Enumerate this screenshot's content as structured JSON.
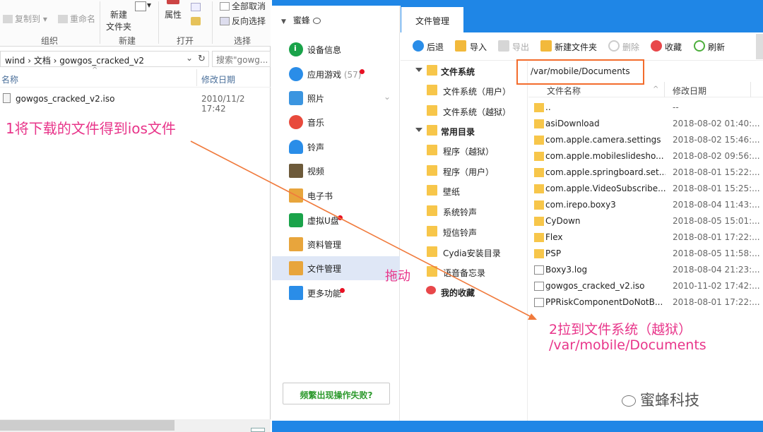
{
  "explorer": {
    "ribbon": {
      "copy_to": "复制到",
      "rename": "重命名",
      "new_folder_line1": "新建",
      "new_folder_line2": "文件夹",
      "properties": "属性",
      "select_none": "全部取消",
      "invert_select": "反向选择",
      "groups": [
        "组织",
        "新建",
        "打开",
        "选择"
      ]
    },
    "breadcrumb": [
      "wind",
      "文档",
      "gowgos_cracked_v2"
    ],
    "search_placeholder": "搜索\"gowg...",
    "columns": {
      "name": "名称",
      "date": "修改日期"
    },
    "files": [
      {
        "name": "gowgos_cracked_v2.iso",
        "date": "2010/11/2 17:42"
      }
    ]
  },
  "app": {
    "device_name": "蜜蜂",
    "nav": [
      {
        "label": "设备信息",
        "icon": "info-icon",
        "color": "#1aa34a"
      },
      {
        "label": "应用游戏",
        "badge": "(57)",
        "icon": "appstore-icon",
        "color": "#2a8de8"
      },
      {
        "label": "照片",
        "icon": "photo-icon",
        "color": "#3b95e0"
      },
      {
        "label": "音乐",
        "icon": "music-icon",
        "color": "#e84a3c"
      },
      {
        "label": "铃声",
        "icon": "bell-icon",
        "color": "#2a8de8"
      },
      {
        "label": "视频",
        "icon": "film-icon",
        "color": "#6d5a3a"
      },
      {
        "label": "电子书",
        "icon": "book-icon",
        "color": "#e8a53c"
      },
      {
        "label": "虚拟U盘",
        "icon": "usb-icon",
        "color": "#1aa34a"
      },
      {
        "label": "资料管理",
        "icon": "contacts-icon",
        "color": "#e8a53c"
      },
      {
        "label": "文件管理",
        "icon": "files-icon",
        "color": "#e8a53c"
      },
      {
        "label": "更多功能",
        "icon": "grid-icon",
        "color": "#2a8de8"
      }
    ],
    "warn_button": "频繁出现操作失败?",
    "tab": "文件管理",
    "toolbar": {
      "back": "后退",
      "import": "导入",
      "export": "导出",
      "new_folder": "新建文件夹",
      "delete": "删除",
      "favorite": "收藏",
      "refresh": "刷新"
    },
    "tree": {
      "filesystem": "文件系统",
      "fs_user": "文件系统（用户）",
      "fs_jail": "文件系统（越狱）",
      "common": "常用目录",
      "common_items": [
        "程序（越狱）",
        "程序（用户）",
        "壁纸",
        "系统铃声",
        "短信铃声",
        "Cydia安装目录",
        "语音备忘录"
      ],
      "favorites": "我的收藏"
    },
    "path": "/var/mobile/Documents",
    "list_columns": {
      "name": "文件名称",
      "date": "修改日期"
    },
    "files": [
      {
        "name": "..",
        "date": "--",
        "type": "folder"
      },
      {
        "name": "asiDownload",
        "date": "2018-08-02 01:40:...",
        "type": "folder"
      },
      {
        "name": "com.apple.camera.settings",
        "date": "2018-08-02 15:46:...",
        "type": "folder"
      },
      {
        "name": "com.apple.mobileslidesho...",
        "date": "2018-08-02 09:56:...",
        "type": "folder"
      },
      {
        "name": "com.apple.springboard.set...",
        "date": "2018-08-01 15:22:...",
        "type": "folder"
      },
      {
        "name": "com.apple.VideoSubscribe...",
        "date": "2018-08-01 15:25:...",
        "type": "folder"
      },
      {
        "name": "com.irepo.boxy3",
        "date": "2018-08-04 11:43:...",
        "type": "folder"
      },
      {
        "name": "CyDown",
        "date": "2018-08-05 15:01:...",
        "type": "folder"
      },
      {
        "name": "Flex",
        "date": "2018-08-01 17:22:...",
        "type": "folder"
      },
      {
        "name": "PSP",
        "date": "2018-08-05 11:58:...",
        "type": "folder"
      },
      {
        "name": "Boxy3.log",
        "date": "2018-08-04 21:23:...",
        "type": "file"
      },
      {
        "name": "gowgos_cracked_v2.iso",
        "date": "2010-11-02 17:42:...",
        "type": "file"
      },
      {
        "name": "PPRiskComponentDoNotB...",
        "date": "2018-08-01 17:22:...",
        "type": "file"
      }
    ]
  },
  "annotations": {
    "step1": "1将下载的文件得到ios文件",
    "drag": "拖动",
    "step2_line1": "2拉到文件系统（越狱）",
    "step2_line2": "/var/mobile/Documents"
  },
  "watermark": "蜜蜂科技",
  "colors": {
    "accent": "#1f86e6",
    "annotation": "#e8358a",
    "arrow": "#f07a3c",
    "highlight_box": "#f36c2c"
  }
}
